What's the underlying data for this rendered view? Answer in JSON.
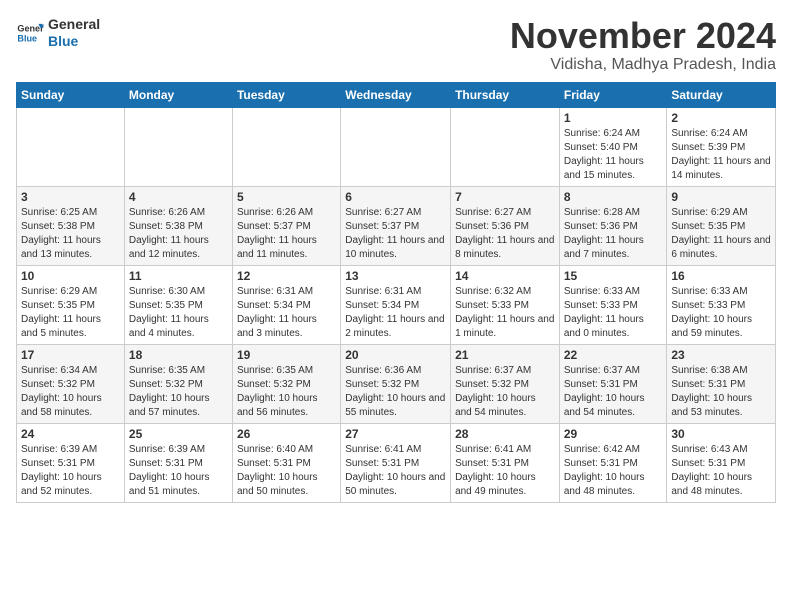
{
  "logo": {
    "text_general": "General",
    "text_blue": "Blue"
  },
  "header": {
    "title": "November 2024",
    "subtitle": "Vidisha, Madhya Pradesh, India"
  },
  "days_of_week": [
    "Sunday",
    "Monday",
    "Tuesday",
    "Wednesday",
    "Thursday",
    "Friday",
    "Saturday"
  ],
  "weeks": [
    [
      {
        "day": "",
        "info": ""
      },
      {
        "day": "",
        "info": ""
      },
      {
        "day": "",
        "info": ""
      },
      {
        "day": "",
        "info": ""
      },
      {
        "day": "",
        "info": ""
      },
      {
        "day": "1",
        "info": "Sunrise: 6:24 AM\nSunset: 5:40 PM\nDaylight: 11 hours and 15 minutes."
      },
      {
        "day": "2",
        "info": "Sunrise: 6:24 AM\nSunset: 5:39 PM\nDaylight: 11 hours and 14 minutes."
      }
    ],
    [
      {
        "day": "3",
        "info": "Sunrise: 6:25 AM\nSunset: 5:38 PM\nDaylight: 11 hours and 13 minutes."
      },
      {
        "day": "4",
        "info": "Sunrise: 6:26 AM\nSunset: 5:38 PM\nDaylight: 11 hours and 12 minutes."
      },
      {
        "day": "5",
        "info": "Sunrise: 6:26 AM\nSunset: 5:37 PM\nDaylight: 11 hours and 11 minutes."
      },
      {
        "day": "6",
        "info": "Sunrise: 6:27 AM\nSunset: 5:37 PM\nDaylight: 11 hours and 10 minutes."
      },
      {
        "day": "7",
        "info": "Sunrise: 6:27 AM\nSunset: 5:36 PM\nDaylight: 11 hours and 8 minutes."
      },
      {
        "day": "8",
        "info": "Sunrise: 6:28 AM\nSunset: 5:36 PM\nDaylight: 11 hours and 7 minutes."
      },
      {
        "day": "9",
        "info": "Sunrise: 6:29 AM\nSunset: 5:35 PM\nDaylight: 11 hours and 6 minutes."
      }
    ],
    [
      {
        "day": "10",
        "info": "Sunrise: 6:29 AM\nSunset: 5:35 PM\nDaylight: 11 hours and 5 minutes."
      },
      {
        "day": "11",
        "info": "Sunrise: 6:30 AM\nSunset: 5:35 PM\nDaylight: 11 hours and 4 minutes."
      },
      {
        "day": "12",
        "info": "Sunrise: 6:31 AM\nSunset: 5:34 PM\nDaylight: 11 hours and 3 minutes."
      },
      {
        "day": "13",
        "info": "Sunrise: 6:31 AM\nSunset: 5:34 PM\nDaylight: 11 hours and 2 minutes."
      },
      {
        "day": "14",
        "info": "Sunrise: 6:32 AM\nSunset: 5:33 PM\nDaylight: 11 hours and 1 minute."
      },
      {
        "day": "15",
        "info": "Sunrise: 6:33 AM\nSunset: 5:33 PM\nDaylight: 11 hours and 0 minutes."
      },
      {
        "day": "16",
        "info": "Sunrise: 6:33 AM\nSunset: 5:33 PM\nDaylight: 10 hours and 59 minutes."
      }
    ],
    [
      {
        "day": "17",
        "info": "Sunrise: 6:34 AM\nSunset: 5:32 PM\nDaylight: 10 hours and 58 minutes."
      },
      {
        "day": "18",
        "info": "Sunrise: 6:35 AM\nSunset: 5:32 PM\nDaylight: 10 hours and 57 minutes."
      },
      {
        "day": "19",
        "info": "Sunrise: 6:35 AM\nSunset: 5:32 PM\nDaylight: 10 hours and 56 minutes."
      },
      {
        "day": "20",
        "info": "Sunrise: 6:36 AM\nSunset: 5:32 PM\nDaylight: 10 hours and 55 minutes."
      },
      {
        "day": "21",
        "info": "Sunrise: 6:37 AM\nSunset: 5:32 PM\nDaylight: 10 hours and 54 minutes."
      },
      {
        "day": "22",
        "info": "Sunrise: 6:37 AM\nSunset: 5:31 PM\nDaylight: 10 hours and 54 minutes."
      },
      {
        "day": "23",
        "info": "Sunrise: 6:38 AM\nSunset: 5:31 PM\nDaylight: 10 hours and 53 minutes."
      }
    ],
    [
      {
        "day": "24",
        "info": "Sunrise: 6:39 AM\nSunset: 5:31 PM\nDaylight: 10 hours and 52 minutes."
      },
      {
        "day": "25",
        "info": "Sunrise: 6:39 AM\nSunset: 5:31 PM\nDaylight: 10 hours and 51 minutes."
      },
      {
        "day": "26",
        "info": "Sunrise: 6:40 AM\nSunset: 5:31 PM\nDaylight: 10 hours and 50 minutes."
      },
      {
        "day": "27",
        "info": "Sunrise: 6:41 AM\nSunset: 5:31 PM\nDaylight: 10 hours and 50 minutes."
      },
      {
        "day": "28",
        "info": "Sunrise: 6:41 AM\nSunset: 5:31 PM\nDaylight: 10 hours and 49 minutes."
      },
      {
        "day": "29",
        "info": "Sunrise: 6:42 AM\nSunset: 5:31 PM\nDaylight: 10 hours and 48 minutes."
      },
      {
        "day": "30",
        "info": "Sunrise: 6:43 AM\nSunset: 5:31 PM\nDaylight: 10 hours and 48 minutes."
      }
    ]
  ]
}
